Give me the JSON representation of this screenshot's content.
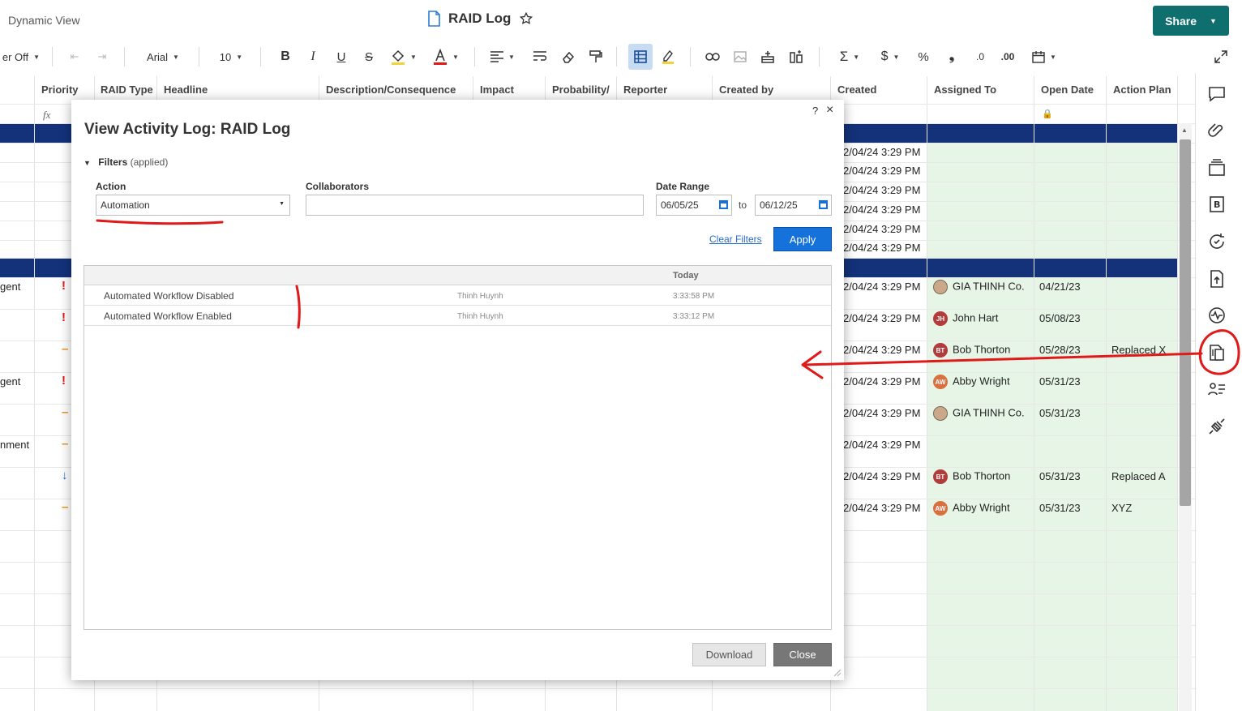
{
  "header": {
    "view_label": "Dynamic View",
    "title": "RAID Log",
    "share_label": "Share"
  },
  "toolbar": {
    "filter_label": "er Off",
    "font_family": "Arial",
    "font_size": "10"
  },
  "grid": {
    "columns": [
      "Priority",
      "RAID Type",
      "Headline",
      "Description/Consequence",
      "Impact",
      "Probability/",
      "Reporter",
      "Created by",
      "Created",
      "Assigned To",
      "Open Date",
      "Action Plan"
    ],
    "created_value": "2/04/24 3:29 PM",
    "rows": [
      {
        "left": "gent",
        "priority": "!",
        "assigned": "GIA THINH Co.",
        "initials": "",
        "open": "04/21/23",
        "plan": ""
      },
      {
        "left": "",
        "priority": "!",
        "assigned": "John Hart",
        "initials": "JH",
        "open": "05/08/23",
        "plan": ""
      },
      {
        "left": "",
        "priority": "–",
        "assigned": "Bob Thorton",
        "initials": "BT",
        "open": "05/28/23",
        "plan": "Replaced X"
      },
      {
        "left": "gent",
        "priority": "!",
        "assigned": "Abby Wright",
        "initials": "AW",
        "open": "05/31/23",
        "plan": ""
      },
      {
        "left": "",
        "priority": "–",
        "assigned": "GIA THINH Co.",
        "initials": "",
        "open": "05/31/23",
        "plan": ""
      },
      {
        "left": "nment",
        "priority": "–",
        "assigned": "",
        "initials": "",
        "open": "",
        "plan": ""
      },
      {
        "left": "",
        "priority": "↓",
        "assigned": "Bob Thorton",
        "initials": "BT",
        "open": "05/31/23",
        "plan": "Replaced A"
      },
      {
        "left": "",
        "priority": "–",
        "assigned": "Abby Wright",
        "initials": "AW",
        "open": "05/31/23",
        "plan": "XYZ"
      }
    ]
  },
  "modal": {
    "help": "?",
    "close_x": "×",
    "title": "View Activity Log: RAID Log",
    "filters_label": "Filters",
    "filters_state": "(applied)",
    "action_label": "Action",
    "action_value": "Automation",
    "collaborators_label": "Collaborators",
    "date_range_label": "Date Range",
    "date_from": "06/05/25",
    "date_to_word": "to",
    "date_to": "06/12/25",
    "clear_filters": "Clear Filters",
    "apply": "Apply",
    "table_header": "Today",
    "entries": [
      {
        "action": "Automated Workflow Disabled",
        "user": "Thinh Huynh",
        "time": "3:33:58 PM"
      },
      {
        "action": "Automated Workflow Enabled",
        "user": "Thinh Huynh",
        "time": "3:33:12 PM"
      }
    ],
    "download": "Download",
    "close": "Close"
  },
  "colors": {
    "share": "#0f6e6e",
    "apply": "#1672db",
    "group_row": "#13327a",
    "assigned_bg": "#e6f5e6",
    "annotation": "#e01919"
  }
}
